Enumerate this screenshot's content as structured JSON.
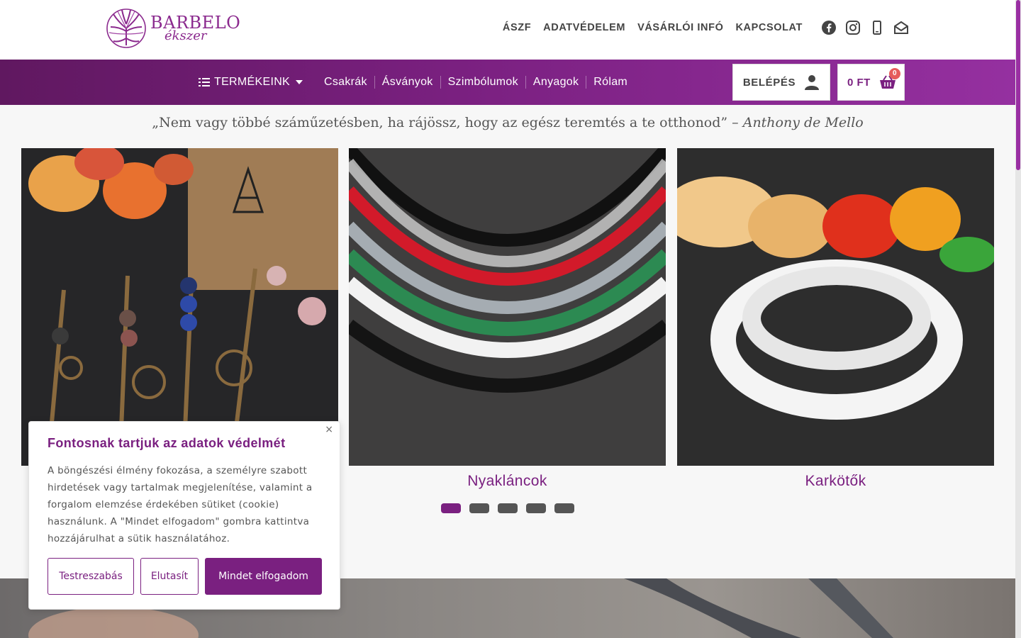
{
  "brand": {
    "title": "BARBELO",
    "subtitle": "ékszer"
  },
  "top_links": [
    "ÁSZF",
    "ADATVÉDELEM",
    "VÁSÁRLÓI INFÓ",
    "KAPCSOLAT"
  ],
  "social_icons": [
    "facebook-icon",
    "instagram-icon",
    "phone-icon",
    "mail-icon"
  ],
  "nav": {
    "products_label": "TERMÉKEINK",
    "links": [
      "Csakrák",
      "Ásványok",
      "Szimbólumok",
      "Anyagok",
      "Rólam"
    ]
  },
  "account": {
    "login_label": "BELÉPÉS"
  },
  "cart": {
    "total": "0 FT",
    "count": "0"
  },
  "quote": {
    "text": "„Nem vagy többé száműzetésben, ha rájössz, hogy az egész teremtés a te otthonod” –",
    "author": "Anthony de Mello"
  },
  "products": [
    {
      "caption": ""
    },
    {
      "caption": "Nyakláncok"
    },
    {
      "caption": "Karkötők"
    }
  ],
  "carousel": {
    "pages": 5,
    "active": 1
  },
  "cookie": {
    "title": "Fontosnak tartjuk az adatok védelmét",
    "text": "A böngészési élmény fokozása, a személyre szabott hirdetések vagy tartalmak megjelenítése, valamint a forgalom elemzése érdekében sütiket (cookie) használunk. A \"Mindet elfogadom\" gombra kattintva hozzájárulhat a sütik használatához.",
    "close": "×",
    "customize": "Testreszabás",
    "reject": "Elutasít",
    "accept": "Mindet elfogadom"
  },
  "colors": {
    "brand": "#7a2080",
    "badge": "#e65c5c"
  }
}
